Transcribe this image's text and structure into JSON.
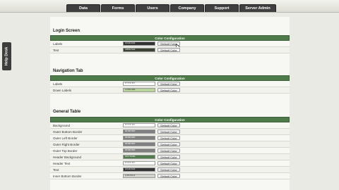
{
  "header": {
    "tabs": [
      "Data",
      "Forms",
      "Users",
      "Company",
      "Support",
      "Server Admin"
    ]
  },
  "sidebar": {
    "help_desk_label": "Help Desk"
  },
  "sections": [
    {
      "title": "Login Screen",
      "bar_label": "Color Configuration",
      "rows": [
        {
          "label": "Labels",
          "value": "333333",
          "color": "#333333",
          "button": "Default Color"
        },
        {
          "label": "Text",
          "value": "3a4233",
          "color": "#3a4233",
          "button": "Default Color"
        }
      ]
    },
    {
      "title": "Navigation Tab",
      "bar_label": "Color Configuration",
      "rows": [
        {
          "label": "Labels",
          "value": "FFFFFF",
          "color": "#ffffff",
          "button": "Default Color"
        },
        {
          "label": "Down Labels",
          "value": "C0DD9A",
          "color": "#b9d49a",
          "button": "Default Color"
        }
      ]
    },
    {
      "title": "General Table",
      "bar_label": "Color Configuration",
      "rows": [
        {
          "label": "Background",
          "value": "FFFFFF",
          "color": "#ffffff",
          "button": "Default Color"
        },
        {
          "label": "Outer Bottom Border",
          "value": "808080",
          "color": "#808080",
          "button": "Default Color"
        },
        {
          "label": "Outer Left Border",
          "value": "808080",
          "color": "#808080",
          "button": "Default Color"
        },
        {
          "label": "Outer Right Border",
          "value": "808080",
          "color": "#808080",
          "button": "Default Color"
        },
        {
          "label": "Outer Top Border",
          "value": "808080",
          "color": "#808080",
          "button": "Default Color"
        },
        {
          "label": "Header Background",
          "value": "507B4A",
          "color": "#507b4a",
          "button": "Default Color"
        },
        {
          "label": "Header Text",
          "value": "FFFFFF",
          "color": "#ffffff",
          "button": "Default Color"
        },
        {
          "label": "Text",
          "value": "333333",
          "color": "#333333",
          "button": "Default Color"
        },
        {
          "label": "Inner Bottom Border",
          "value": "C8C8C2",
          "color": "#d2d2cc",
          "button": "Default Color"
        }
      ]
    }
  ]
}
